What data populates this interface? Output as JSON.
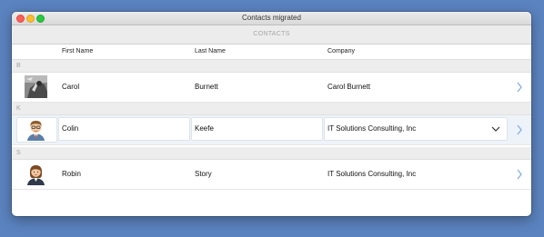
{
  "window": {
    "title": "Contacts migrated"
  },
  "toolbar": {
    "title": "CONTACTS"
  },
  "columns": {
    "first_name": "First Name",
    "last_name": "Last Name",
    "company": "Company"
  },
  "sections": [
    {
      "letter": "B"
    },
    {
      "letter": "K"
    },
    {
      "letter": "S"
    }
  ],
  "contacts": [
    {
      "first": "Carol",
      "last": "Burnett",
      "company": "Carol Burnett",
      "avatar": "photo-avatar-icon"
    },
    {
      "first": "Colin",
      "last": "Keefe",
      "company": "IT Solutions Consulting, Inc",
      "avatar": "male-avatar-icon"
    },
    {
      "first": "Robin",
      "last": "Story",
      "company": "IT Solutions Consulting, Inc",
      "avatar": "female-avatar-icon"
    }
  ],
  "colors": {
    "accent": "#5b9bd5",
    "desktop": "#5b83bf"
  }
}
